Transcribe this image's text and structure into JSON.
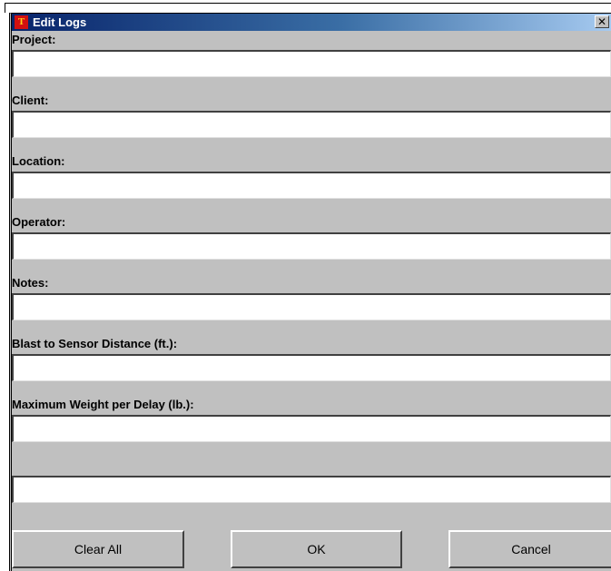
{
  "window": {
    "title": "Edit Logs",
    "icon": "tt-logo-icon",
    "close_symbol": "✕"
  },
  "fields": [
    {
      "label": "Project:",
      "value": ""
    },
    {
      "label": "Client:",
      "value": ""
    },
    {
      "label": "Location:",
      "value": ""
    },
    {
      "label": "Operator:",
      "value": ""
    },
    {
      "label": "Notes:",
      "value": ""
    },
    {
      "label": "Blast to Sensor Distance (ft.):",
      "value": ""
    },
    {
      "label": "Maximum Weight per Delay (lb.):",
      "value": ""
    },
    {
      "label": "",
      "value": ""
    }
  ],
  "buttons": {
    "clear_all": "Clear All",
    "ok": "OK",
    "cancel": "Cancel"
  }
}
